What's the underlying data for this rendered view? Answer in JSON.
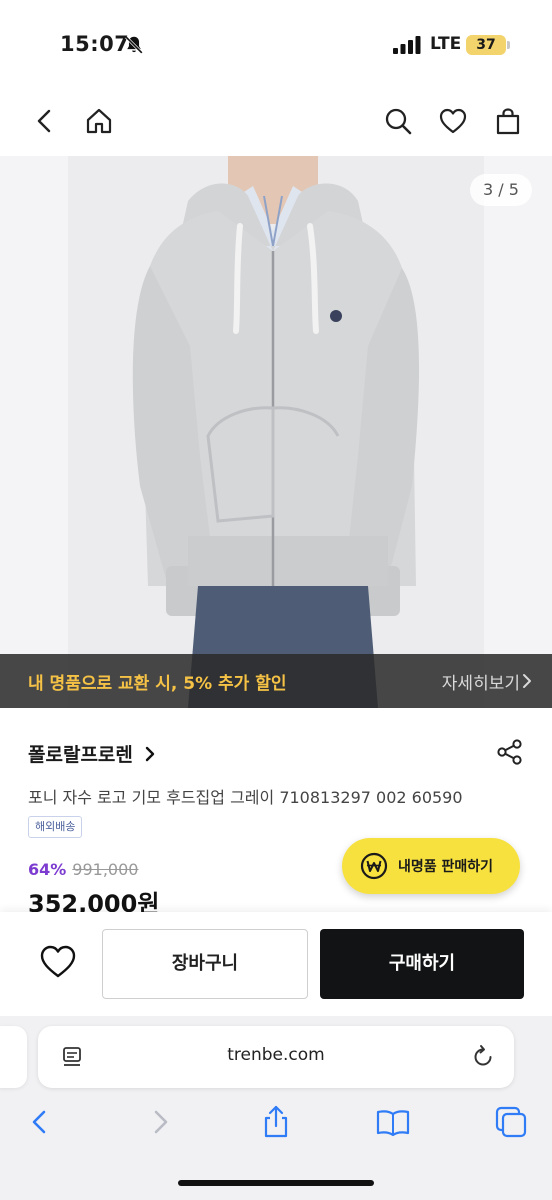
{
  "status_bar": {
    "time": "15:07",
    "network": "LTE",
    "battery": "37"
  },
  "nav": {
    "icons": [
      "back-icon",
      "home-icon",
      "search-icon",
      "heart-icon",
      "bag-icon"
    ]
  },
  "gallery": {
    "counter": "3 / 5",
    "promo_text": "내 명품으로 교환 시, 5% 추가 할인",
    "promo_link": "자세히보기"
  },
  "product": {
    "brand": "폴로랄프로렌",
    "title": "포니 자수 로고 기모 후드집업 그레이 710813297 002 60590",
    "shipping_badge": "해외배송",
    "discount": "64%",
    "original_price": "991,000",
    "price": "352,000원"
  },
  "sell_button": {
    "label": "내명품 판매하기"
  },
  "actions": {
    "cart_label": "장바구니",
    "buy_label": "구매하기"
  },
  "browser": {
    "url": "trenbe.com"
  },
  "colors": {
    "accent_yellow": "#f7e13f",
    "promo_text": "#f5c246",
    "discount_purple": "#7d3cd0",
    "buy_button": "#121314",
    "ios_blue": "#2f7cf6"
  }
}
